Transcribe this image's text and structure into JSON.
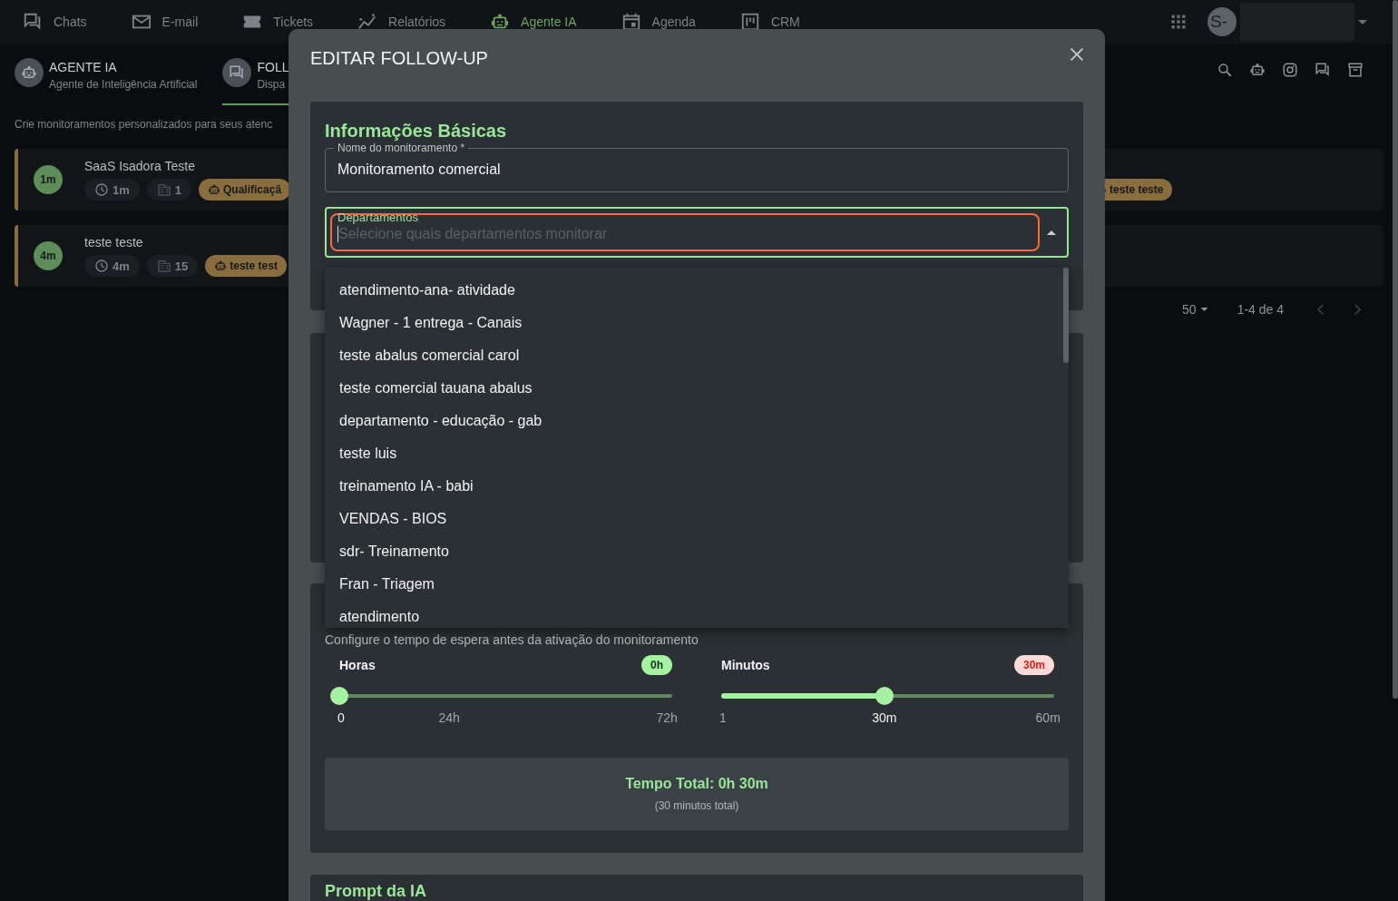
{
  "nav": {
    "items": [
      {
        "label": "Chats",
        "selected": false
      },
      {
        "label": "E-mail",
        "selected": false
      },
      {
        "label": "Tickets",
        "selected": false
      },
      {
        "label": "Relatórios",
        "selected": false
      },
      {
        "label": "Agente IA",
        "selected": true
      },
      {
        "label": "Agenda",
        "selected": false
      },
      {
        "label": "CRM",
        "selected": false
      }
    ],
    "avatar": "S-"
  },
  "page": {
    "tabs": [
      {
        "title": "AGENTE IA",
        "subtitle": "Agente de Inteligência Artificial",
        "selected": false
      },
      {
        "title": "FOLL",
        "subtitle": "Dispa",
        "selected": true
      }
    ],
    "description": "Crie monitoramentos personalizados para seus atenc",
    "monitors": [
      {
        "badge": "1m",
        "name": "SaaS Isadora Teste",
        "wait": "1m",
        "departments": "1",
        "agents": [
          "Qualificaçã",
          "teste teste"
        ]
      },
      {
        "badge": "4m",
        "name": "teste teste",
        "wait": "4m",
        "departments": "15",
        "agents": [
          "teste test"
        ]
      }
    ],
    "pagination": {
      "per_page": "50",
      "range": "1-4 de 4"
    }
  },
  "modal": {
    "title": "EDITAR FOLLOW-UP",
    "basic": {
      "title": "Informações Básicas",
      "name_field": {
        "label": "Nome do monitoramento *",
        "value": "Monitoramento comercial"
      },
      "departments_field": {
        "label": "Departamentos",
        "placeholder": "Selecione quais departamentos monitorar",
        "expanded": true,
        "options": [
          "atendimento-ana- atividade",
          "Wagner - 1 entrega - Canais",
          "teste abalus comercial carol",
          "teste comercial tauana abalus",
          "departamento - educação - gab",
          "teste luis",
          "treinamento IA - babi",
          "VENDAS - BIOS",
          "sdr- Treinamento",
          "Fran - Triagem",
          "atendimento"
        ]
      }
    },
    "timing": {
      "description": "Configure o tempo de espera antes da ativação do monitoramento",
      "sliders": [
        {
          "label": "Horas",
          "value": "0h",
          "kind": "hours",
          "level": 0,
          "marks": [
            {
              "label": "0",
              "active": true
            },
            {
              "label": "24h",
              "active": false
            },
            {
              "label": "72h",
              "active": false
            }
          ]
        },
        {
          "label": "Minutos",
          "value": "30m",
          "kind": "minutes",
          "level": 0.49,
          "marks": [
            {
              "label": "1",
              "active": false
            },
            {
              "label": "30m",
              "active": true
            },
            {
              "label": "60m",
              "active": false
            }
          ]
        }
      ],
      "total": "Tempo Total: 0h 30m",
      "total_note": "(30 minutos total)"
    },
    "prompt": {
      "title": "Prompt da IA"
    }
  }
}
